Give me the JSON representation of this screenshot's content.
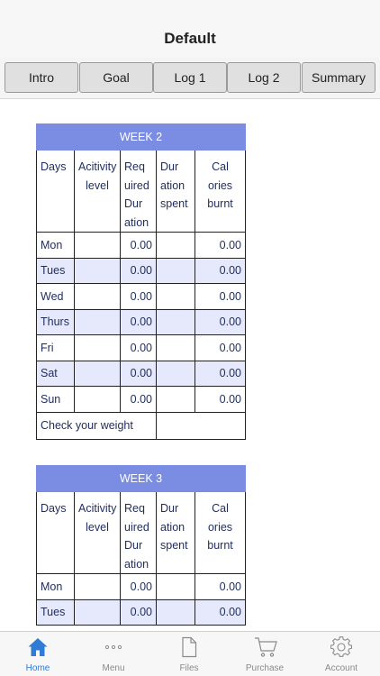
{
  "header": {
    "title": "Default"
  },
  "tabs": [
    "Intro",
    "Goal",
    "Log 1",
    "Log 2",
    "Summary"
  ],
  "column_headers": [
    "Days",
    "Acitivity level",
    "Req uired Dur ation",
    "Dur ation spent",
    "Cal ories burnt"
  ],
  "column_header_lines": [
    [
      "Days"
    ],
    [
      "Acitivity",
      "level"
    ],
    [
      "Req",
      "uired",
      "Dur",
      "ation"
    ],
    [
      "Dur",
      "ation",
      "spent"
    ],
    [
      "Cal",
      "ories",
      "burnt"
    ]
  ],
  "weeks": [
    {
      "title": "WEEK 2",
      "rows": [
        {
          "day": "Mon",
          "required": "0.00",
          "calories": "0.00"
        },
        {
          "day": "Tues",
          "required": "0.00",
          "calories": "0.00"
        },
        {
          "day": "Wed",
          "required": "0.00",
          "calories": "0.00"
        },
        {
          "day": "Thurs",
          "required": "0.00",
          "calories": "0.00"
        },
        {
          "day": "Fri",
          "required": "0.00",
          "calories": "0.00"
        },
        {
          "day": "Sat",
          "required": "0.00",
          "calories": "0.00"
        },
        {
          "day": "Sun",
          "required": "0.00",
          "calories": "0.00"
        }
      ],
      "check_label": "Check your weight"
    },
    {
      "title": "WEEK 3",
      "rows": [
        {
          "day": "Mon",
          "required": "0.00",
          "calories": "0.00"
        },
        {
          "day": "Tues",
          "required": "0.00",
          "calories": "0.00"
        }
      ]
    }
  ],
  "bottom_nav": [
    {
      "label": "Home",
      "icon": "home-icon",
      "active": true
    },
    {
      "label": "Menu",
      "icon": "more-dots-icon",
      "active": false
    },
    {
      "label": "Files",
      "icon": "file-icon",
      "active": false
    },
    {
      "label": "Purchase",
      "icon": "cart-icon",
      "active": false
    },
    {
      "label": "Account",
      "icon": "gear-icon",
      "active": false
    }
  ],
  "colors": {
    "accent": "#2f7bd6",
    "week_header": "#7b8de2",
    "alt_row": "#e6e9fb",
    "table_text": "#1f2d5c"
  }
}
